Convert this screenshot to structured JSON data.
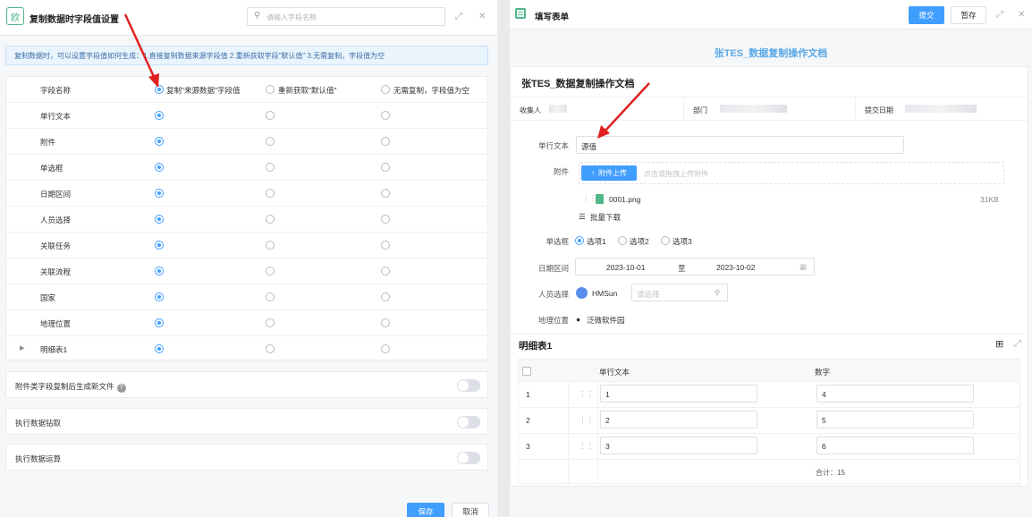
{
  "left_panel": {
    "logo_glyph": "欧",
    "title": "复制数据时字段值设置",
    "search_placeholder": "请输入字段名称",
    "notice": "复制数据时，可以设置字段值如何生成：1.直接复制数据来源字段值 2.重新获取字段\"默认值\" 3.无需复制，字段值为空",
    "columns": {
      "field": "字段名称",
      "opt1": "复制\"来源数据\"字段值",
      "opt2": "重新获取\"默认值\"",
      "opt3": "无需复制，字段值为空"
    },
    "fields": [
      {
        "name": "单行文本",
        "selected": 1
      },
      {
        "name": "附件",
        "selected": 1
      },
      {
        "name": "单选框",
        "selected": 1
      },
      {
        "name": "日期区间",
        "selected": 1
      },
      {
        "name": "人员选择",
        "selected": 1
      },
      {
        "name": "关联任务",
        "selected": 1
      },
      {
        "name": "关联流程",
        "selected": 1
      },
      {
        "name": "国家",
        "selected": 1
      },
      {
        "name": "地理位置",
        "selected": 1
      },
      {
        "name": "明细表1",
        "selected": 1,
        "expandable": true
      }
    ],
    "options": [
      {
        "label": "附件类字段复制后生成新文件",
        "help": "?",
        "enabled": false
      },
      {
        "label": "执行数据钻取",
        "enabled": false
      },
      {
        "label": "执行数据运算",
        "enabled": false
      }
    ],
    "save_label": "保存",
    "cancel_label": "取消"
  },
  "right_panel": {
    "title": "填写表单",
    "submit_label": "提交",
    "draft_label": "暂存",
    "doc_banner": "张TES_数据复制操作文档",
    "form_title": "张TES_数据复制操作文档",
    "meta": {
      "collector": "收集人",
      "department": "部门",
      "submit_date": "提交日期"
    },
    "single_text": {
      "label": "单行文本",
      "value": "源值"
    },
    "attachment": {
      "label": "附件",
      "upload_label": "附件上传",
      "drop_hint": "点击或拖拽上传附件",
      "file_name": "0001.png",
      "file_size": "31KB",
      "batch_download": "批量下载"
    },
    "radio": {
      "label": "单选框",
      "options": [
        "选项1",
        "选项2",
        "选项3"
      ],
      "selected": 0
    },
    "date_range": {
      "label": "日期区间",
      "start": "2023-10-01",
      "separator": "至",
      "end": "2023-10-02"
    },
    "person": {
      "label": "人员选择",
      "name": "HMSun",
      "placeholder": "请选择"
    },
    "location": {
      "label": "地理位置",
      "value": "泛微软件园"
    },
    "detail_table": {
      "title": "明细表1",
      "columns": [
        "单行文本",
        "数字"
      ],
      "rows": [
        {
          "index": "1",
          "text": "1",
          "number": "4"
        },
        {
          "index": "2",
          "text": "2",
          "number": "5"
        },
        {
          "index": "3",
          "text": "3",
          "number": "6"
        }
      ],
      "total": "合计：15"
    }
  },
  "colors": {
    "primary": "#409eff",
    "banner": "#5aa8e6",
    "logo": "#52b788",
    "arrow": "#e02020"
  }
}
